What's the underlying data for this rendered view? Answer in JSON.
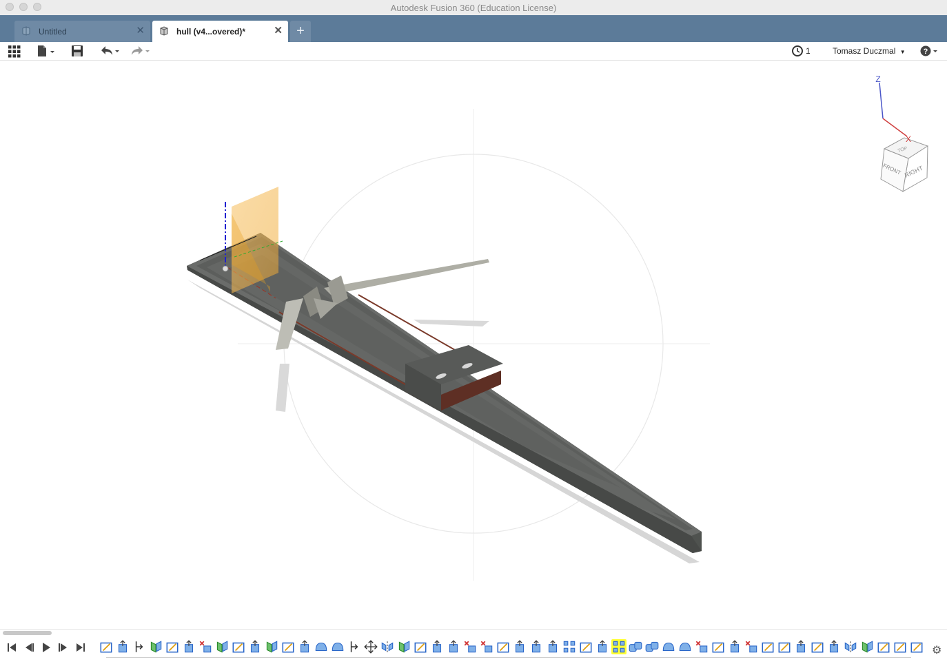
{
  "window": {
    "title": "Autodesk Fusion 360 (Education License)"
  },
  "tabs": [
    {
      "label": "Untitled",
      "active": false,
      "icon": "document-icon"
    },
    {
      "label": "hull (v4...overed)*",
      "active": true,
      "icon": "component-icon"
    }
  ],
  "new_tab_label": "+",
  "toolbar": {
    "jobs_count": "1",
    "user_name": "Tomasz Duczmal",
    "icons": [
      "app-grid-icon",
      "file-menu-icon",
      "save-icon",
      "undo-icon",
      "redo-icon",
      "job-status-icon",
      "help-icon"
    ]
  },
  "viewcube": {
    "top": "TOP",
    "front": "FRONT",
    "right": "RIGHT",
    "axis_z": "Z",
    "axis_x": "X"
  },
  "timeline": {
    "playback": [
      "skip-to-start-icon",
      "step-back-icon",
      "play-icon",
      "step-forward-icon",
      "skip-to-end-icon"
    ],
    "feature_count": 50,
    "active_feature_index": 31,
    "settings_icon": "gear-icon"
  },
  "colors": {
    "tabbar": "#5c7b99",
    "hull": "#5a5c5a",
    "plane": "#f5b041",
    "active_feature": "#ffff33"
  }
}
